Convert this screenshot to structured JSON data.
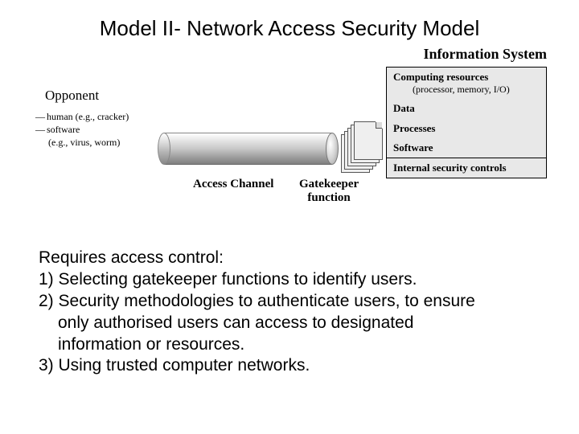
{
  "title": "Model II- Network Access Security Model",
  "info_system_title": "Information System",
  "info_box": {
    "computing": "Computing resources",
    "computing_sub": "(processor, memory, I/O)",
    "data": "Data",
    "processes": "Processes",
    "software": "Software",
    "internal": "Internal security controls"
  },
  "opponent": {
    "title": "Opponent",
    "row1a": "human (e.g., cracker)",
    "row2a": "software",
    "row2b": "(e.g., virus, worm)"
  },
  "access_channel": "Access Channel",
  "gatekeeper_l1": "Gatekeeper",
  "gatekeeper_l2": "function",
  "bullets": {
    "intro": "Requires access control:",
    "l1": "1) Selecting gatekeeper functions to identify users.",
    "l2a": "2) Security methodologies to authenticate users, to ensure",
    "l2b": "only authorised users can access to designated",
    "l2c": "information or resources.",
    "l3": "3) Using trusted computer networks."
  }
}
